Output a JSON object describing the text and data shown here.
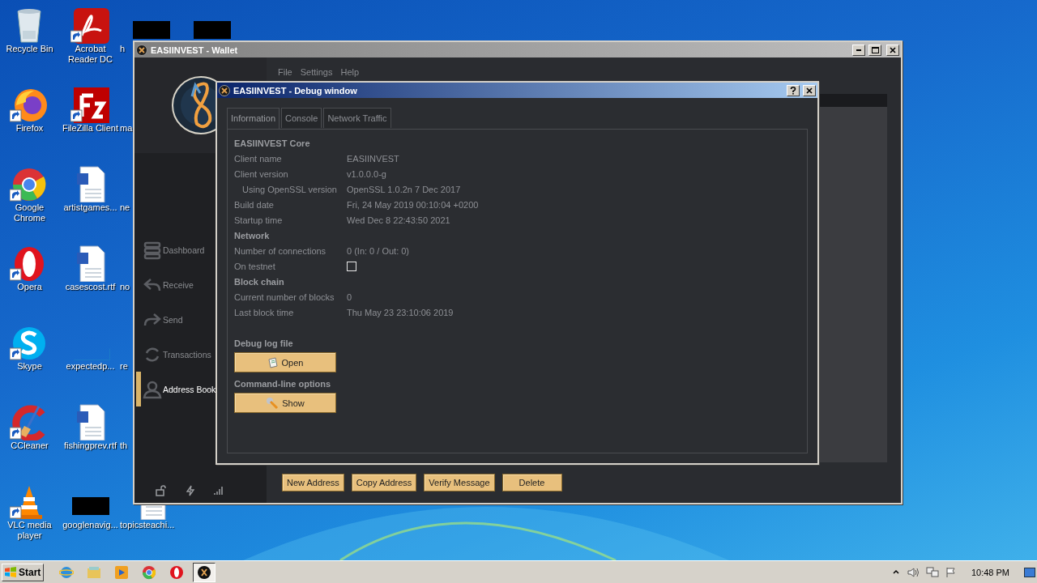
{
  "desktop_icons": [
    {
      "label": "Recycle Bin",
      "kind": "recycle"
    },
    {
      "label": "Firefox",
      "kind": "firefox",
      "shortcut": true
    },
    {
      "label": "Google Chrome",
      "kind": "chrome",
      "shortcut": true
    },
    {
      "label": "Opera",
      "kind": "opera",
      "shortcut": true
    },
    {
      "label": "Skype",
      "kind": "skype",
      "shortcut": true
    },
    {
      "label": "CCleaner",
      "kind": "ccleaner",
      "shortcut": true
    },
    {
      "label": "VLC media player",
      "kind": "vlc",
      "shortcut": true
    },
    {
      "label": "Acrobat Reader DC",
      "kind": "acrobat",
      "shortcut": true
    },
    {
      "label": "FileZilla Client",
      "kind": "filezilla",
      "shortcut": true
    },
    {
      "label": "artistgames...",
      "kind": "document"
    },
    {
      "label": "casescost.rtf",
      "kind": "document"
    },
    {
      "label": "expectedp...",
      "kind": "blank"
    },
    {
      "label": "fishingprev.rtf",
      "kind": "document"
    },
    {
      "label": "googlenavig...",
      "kind": "redacted"
    },
    {
      "label": "h",
      "kind": "redacted"
    },
    {
      "label": "ma",
      "kind": "hidden"
    },
    {
      "label": "ne",
      "kind": "hidden"
    },
    {
      "label": "no",
      "kind": "hidden"
    },
    {
      "label": "re",
      "kind": "hidden"
    },
    {
      "label": "th",
      "kind": "hidden"
    },
    {
      "label": "topicsteachi...",
      "kind": "document"
    },
    {
      "kind": "redacted"
    }
  ],
  "wallet": {
    "title": "EASIINVEST - Wallet",
    "menu": [
      "File",
      "Settings",
      "Help"
    ],
    "nav": [
      {
        "label": "Dashboard",
        "kind": "dashboard",
        "selected": false
      },
      {
        "label": "Receive",
        "kind": "receive",
        "selected": false
      },
      {
        "label": "Send",
        "kind": "send",
        "selected": false
      },
      {
        "label": "Transactions",
        "kind": "transactions",
        "selected": false
      },
      {
        "label": "Address Book",
        "kind": "addressbook",
        "selected": true
      }
    ],
    "buttons": [
      "New Address",
      "Copy Address",
      "Verify Message",
      "Delete"
    ]
  },
  "debug": {
    "title": "EASIINVEST - Debug window",
    "tabs": [
      {
        "label": "Information",
        "selected": true
      },
      {
        "label": "Console",
        "selected": false
      },
      {
        "label": "Network Traffic",
        "selected": false
      }
    ],
    "rows": [
      {
        "kind": "heading",
        "label": "EASIINVEST Core"
      },
      {
        "kind": "field",
        "label": "Client name",
        "value": "EASIINVEST"
      },
      {
        "kind": "field",
        "label": "Client version",
        "value": "v1.0.0.0-g"
      },
      {
        "kind": "subfield",
        "label": "Using OpenSSL version",
        "value": "OpenSSL 1.0.2n  7 Dec 2017"
      },
      {
        "kind": "field",
        "label": "Build date",
        "value": "Fri, 24 May 2019 00:10:04 +0200"
      },
      {
        "kind": "field",
        "label": "Startup time",
        "value": "Wed Dec 8 22:43:50 2021"
      },
      {
        "kind": "heading",
        "label": "Network"
      },
      {
        "kind": "field",
        "label": "Number of connections",
        "value": "0 (In: 0 / Out: 0)"
      },
      {
        "kind": "checkbox",
        "label": "On testnet",
        "checked": false
      },
      {
        "kind": "heading",
        "label": "Block chain"
      },
      {
        "kind": "field",
        "label": "Current number of blocks",
        "value": "0"
      },
      {
        "kind": "field",
        "label": "Last block time",
        "value": "Thu May 23 23:10:06 2019"
      }
    ],
    "debug_log": {
      "heading": "Debug log file",
      "button": "Open"
    },
    "command_line": {
      "heading": "Command-line options",
      "button": "Show"
    }
  },
  "taskbar": {
    "start": "Start",
    "apps": [
      {
        "kind": "ie",
        "selected": false
      },
      {
        "kind": "explorer",
        "selected": false
      },
      {
        "kind": "media",
        "selected": false
      },
      {
        "kind": "chrome",
        "selected": false
      },
      {
        "kind": "opera",
        "selected": false
      },
      {
        "kind": "wallet",
        "selected": true
      }
    ],
    "clock": "10:48 PM"
  }
}
